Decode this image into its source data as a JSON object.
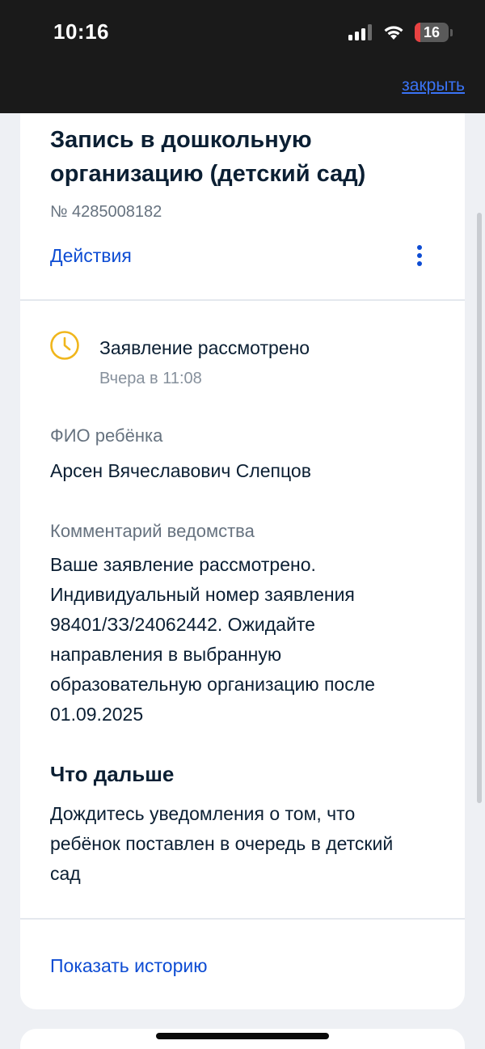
{
  "status_bar": {
    "time": "10:16",
    "battery_level": "16",
    "battery_fraction": 0.16
  },
  "header": {
    "close_label": "закрыть"
  },
  "application": {
    "title": "Запись в дошкольную организацию (детский сад)",
    "number": "№ 4285008182",
    "actions_label": "Действия",
    "more_icon": "vertical-dots-icon"
  },
  "status": {
    "icon": "clock-icon",
    "icon_color": "#f0b61c",
    "title": "Заявление рассмотрено",
    "time": "Вчера в 11:08"
  },
  "child": {
    "label": "ФИО ребёнка",
    "value": "Арсен Вячеславович Слепцов"
  },
  "comment": {
    "label": "Комментарий ведомства",
    "lines": [
      "Ваше заявление рассмотрено.",
      "Индивидуальный номер заявления",
      "98401/ЗЗ/24062442. Ожидайте",
      "направления в выбранную",
      "образовательную организацию после",
      "01.09.2025"
    ]
  },
  "next": {
    "title": "Что дальше",
    "lines": [
      "Дождитесь уведомления о том, что",
      "ребёнок поставлен в очередь в детский",
      "сад"
    ]
  },
  "history": {
    "label": "Показать историю"
  },
  "colors": {
    "link": "#0d4cd3",
    "close_link": "#3a73f5",
    "text": "#0b1f33",
    "secondary": "#66727f"
  }
}
